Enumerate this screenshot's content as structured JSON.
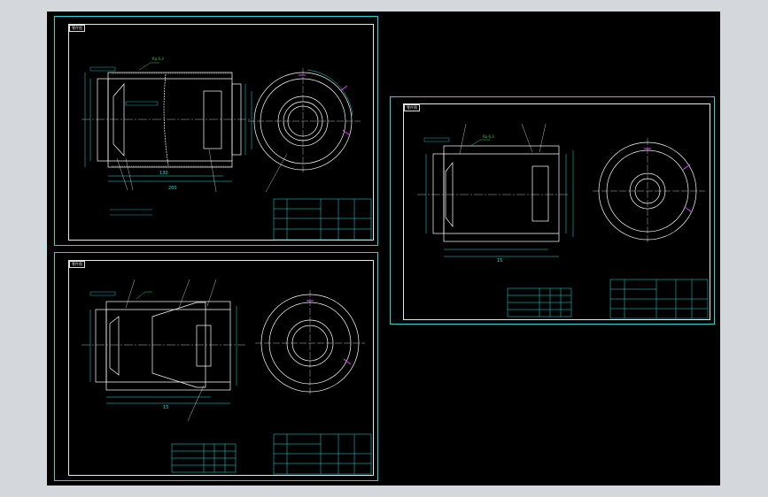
{
  "viewport": {
    "background": "#000000",
    "frame": "#d4d7dc"
  },
  "colors": {
    "outline": "#ffffff",
    "border": "#2fd1d1",
    "dimension": "#22e0e0",
    "annotation": "#2bd24b",
    "highlight": "#e040ff",
    "leader": "#e8e8e8"
  },
  "sheets": [
    {
      "id": "A",
      "title": "零件图",
      "dims": {
        "overall": "130",
        "shell": "200"
      }
    },
    {
      "id": "B",
      "title": "零件图",
      "dims": {
        "overall": "15"
      }
    },
    {
      "id": "C",
      "title": "零件图",
      "dims": {
        "overall": "15"
      }
    }
  ]
}
